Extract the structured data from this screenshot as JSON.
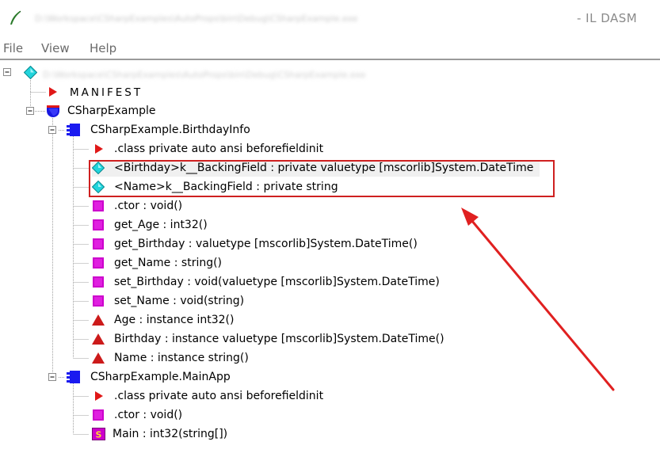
{
  "window": {
    "path": "D:\\Workspace\\CSharpExamples\\AutoProps\\bin\\Debug\\CSharpExample.exe",
    "app_suffix": "- IL DASM"
  },
  "menu": [
    "File",
    "View",
    "Help"
  ],
  "tree": {
    "root": "D:\\Workspace\\CSharpExamples\\AutoProps\\bin\\Debug\\CSharpExample.exe",
    "manifest": "MANIFEST",
    "namespace": "CSharpExample",
    "class1": {
      "name": "CSharpExample.BirthdayInfo",
      "members": [
        ".class private auto ansi beforefieldinit",
        "<Birthday>k__BackingField : private valuetype [mscorlib]System.DateTime",
        "<Name>k__BackingField : private string",
        ".ctor : void()",
        "get_Age : int32()",
        "get_Birthday : valuetype [mscorlib]System.DateTime()",
        "get_Name : string()",
        "set_Birthday : void(valuetype [mscorlib]System.DateTime)",
        "set_Name : void(string)",
        "Age : instance int32()",
        "Birthday : instance valuetype [mscorlib]System.DateTime()",
        "Name : instance string()"
      ]
    },
    "class2": {
      "name": "CSharpExample.MainApp",
      "members": [
        ".class private auto ansi beforefieldinit",
        ".ctor : void()",
        "Main : int32(string[])"
      ]
    }
  },
  "icons": {
    "window": "quill-icon",
    "assembly": "cyan-diamond-icon",
    "manifest": "red-triangle-icon",
    "namespace": "blue-shield-icon",
    "class": "blue-class-icon",
    "field": "cyan-diamond-icon",
    "method": "magenta-square-icon",
    "property": "red-up-triangle-icon",
    "static": "s-box-icon"
  },
  "colors": {
    "highlight_border": "#cf2020",
    "annotation_arrow": "#e02020",
    "method": "#cc00cc",
    "field": "#20c8d0",
    "class": "#1a1af0",
    "property": "#cc1a1a"
  }
}
